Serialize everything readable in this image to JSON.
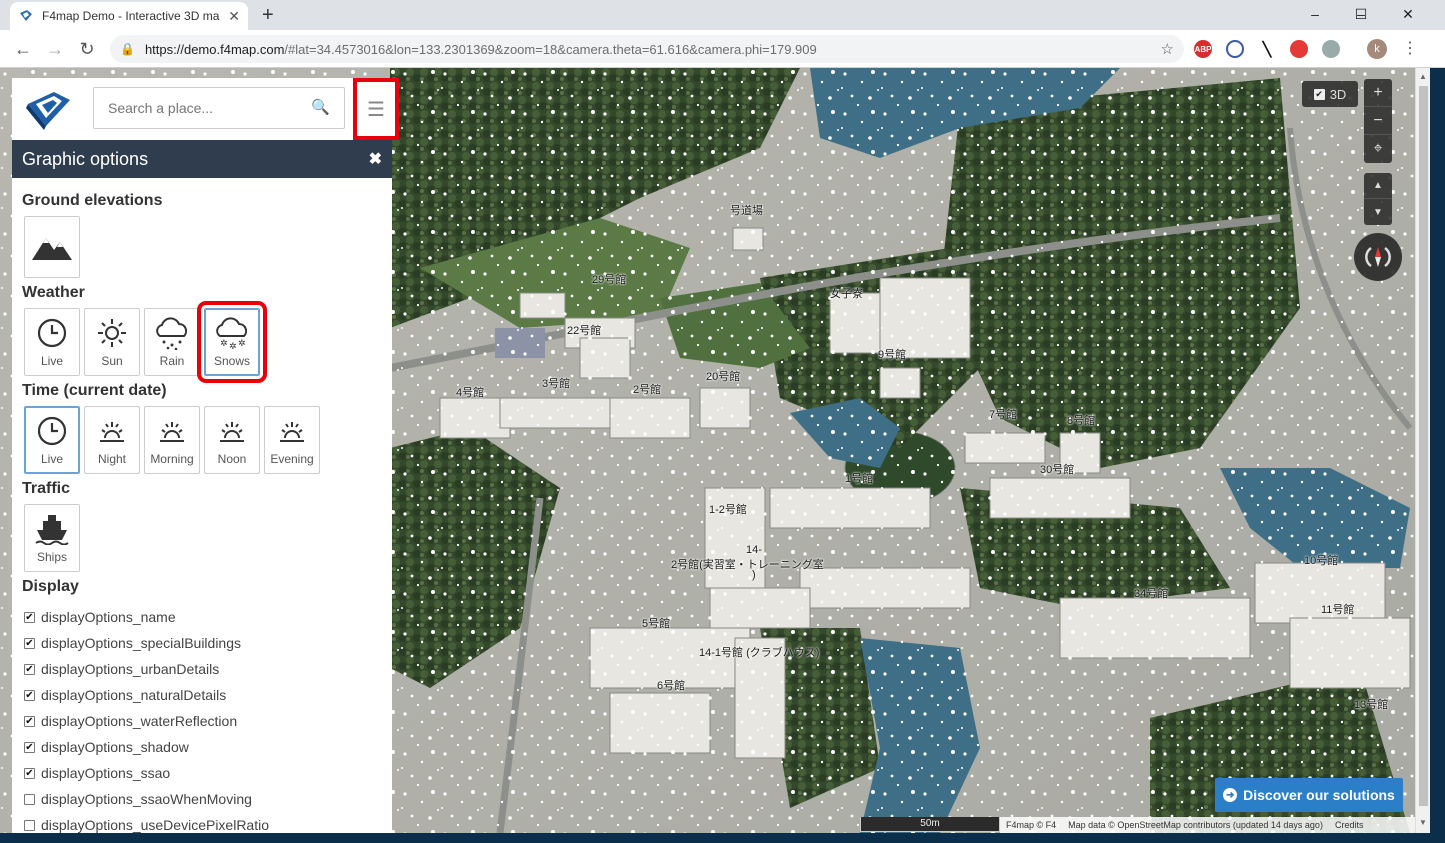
{
  "browser": {
    "tab_title": "F4map Demo - Interactive 3D ma",
    "tab_close": "✕",
    "new_tab": "+",
    "url_host": "https://demo.f4map.com",
    "url_rest": "/#lat=34.4573016&lon=133.2301369&zoom=18&camera.theta=61.616&camera.phi=179.909",
    "ext_abp": "ABP",
    "avatar_letter": "k",
    "window_controls": [
      "–",
      "☐",
      "✕"
    ]
  },
  "search": {
    "placeholder": "Search a place..."
  },
  "panel": {
    "title": "Graphic options",
    "close": "✖",
    "sections": {
      "ground": "Ground elevations",
      "weather": "Weather",
      "time": "Time (current date)",
      "traffic": "Traffic",
      "display": "Display"
    },
    "weather_options": [
      "Live",
      "Sun",
      "Rain",
      "Snows"
    ],
    "time_options": [
      "Live",
      "Night",
      "Morning",
      "Noon",
      "Evening"
    ],
    "traffic_options": [
      "Ships"
    ],
    "display_options": [
      {
        "label": "displayOptions_name",
        "checked": true
      },
      {
        "label": "displayOptions_specialBuildings",
        "checked": true
      },
      {
        "label": "displayOptions_urbanDetails",
        "checked": true
      },
      {
        "label": "displayOptions_naturalDetails",
        "checked": true
      },
      {
        "label": "displayOptions_waterReflection",
        "checked": true
      },
      {
        "label": "displayOptions_shadow",
        "checked": true
      },
      {
        "label": "displayOptions_ssao",
        "checked": true
      },
      {
        "label": "displayOptions_ssaoWhenMoving",
        "checked": false
      },
      {
        "label": "displayOptions_useDevicePixelRatio",
        "checked": false
      }
    ]
  },
  "map": {
    "btn_3d": "3D",
    "zoom_in": "+",
    "zoom_out": "−",
    "discover": "Discover our solutions",
    "scale": "50m",
    "attribution": {
      "f4": "F4map © F4",
      "osm": "Map data © OpenStreetMap contributors (updated 14 days ago)",
      "credits": "Credits"
    },
    "labels": [
      "号道場",
      "29号館",
      "22号館",
      "女子寮",
      "9号館",
      "4号館",
      "3号館",
      "2号館",
      "20号館",
      "7号館",
      "8号館",
      "30号館",
      "1号館",
      "1-2号館",
      "14-",
      "2号館(実習室・トレーニング室",
      ")",
      "10号館",
      "34号館",
      "11号館",
      "5号館",
      "14-1号館 (クラブハウス)",
      "6号館",
      "13号館"
    ]
  },
  "colors": {
    "panel_header": "#2f3d4e",
    "highlight": "#e8000b",
    "discover": "#2a7fc8",
    "water": "#3e6f86",
    "forest": "#2f4a2a"
  }
}
